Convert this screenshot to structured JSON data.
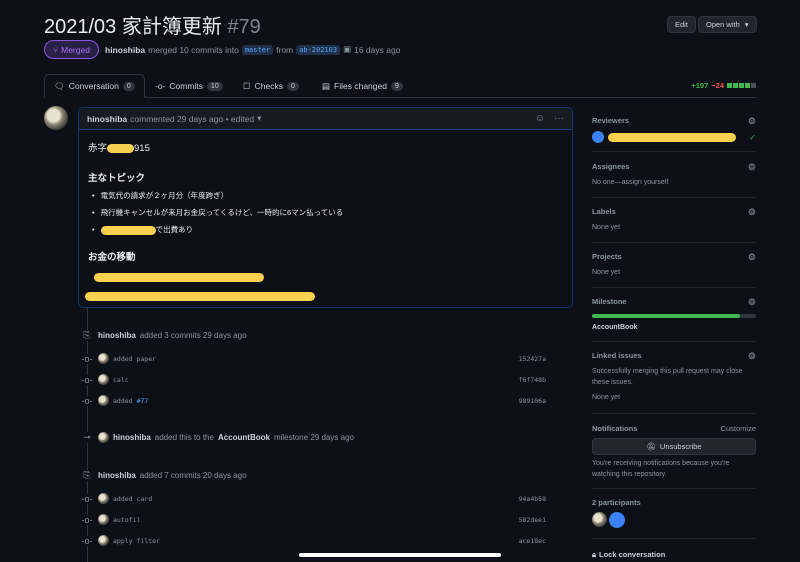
{
  "header": {
    "title": "2021/03 家計簿更新",
    "number": "#79",
    "edit": "Edit",
    "open_with": "Open with"
  },
  "status": {
    "badge": "Merged",
    "author": "hinoshiba",
    "merged_text": "merged 10 commits into",
    "base": "master",
    "from": "from",
    "head": "ab-202103",
    "time": "16 days ago"
  },
  "tabs": [
    {
      "label": "Conversation",
      "count": "0"
    },
    {
      "label": "Commits",
      "count": "10"
    },
    {
      "label": "Checks",
      "count": "0"
    },
    {
      "label": "Files changed",
      "count": "9"
    }
  ],
  "diffstat": {
    "add": "+197",
    "del": "−24"
  },
  "comment": {
    "author": "hinoshiba",
    "meta": "commented 29 days ago • edited",
    "line1_prefix": "赤字",
    "line1_suffix": "915",
    "h_topics": "主なトピック",
    "topics": [
      "電気代の請求が２ヶ月分（年度跨ぎ）",
      "飛行機キャンセルが来月お金戻ってくるけど、一時的に6マン払っている",
      "で出費あり"
    ],
    "h_money": "お金の移動"
  },
  "timeline": [
    {
      "type": "push",
      "author": "hinoshiba",
      "text": "added 3 commits 29 days ago"
    },
    {
      "type": "commit",
      "msg": "added paper",
      "sha": "152427a"
    },
    {
      "type": "commit",
      "msg": "calc",
      "sha": "f6f748b"
    },
    {
      "type": "commit",
      "msg": "added",
      "link": "#77",
      "sha": "989106a"
    },
    {
      "type": "milestone",
      "author": "hinoshiba",
      "text1": "added this to the",
      "milestone": "AccountBook",
      "text2": "milestone 29 days ago"
    },
    {
      "type": "push",
      "author": "hinoshiba",
      "text": "added 7 commits 20 days ago"
    },
    {
      "type": "commit",
      "msg": "added card",
      "sha": "94a4b58"
    },
    {
      "type": "commit",
      "msg": "autofil",
      "sha": "582dee1"
    },
    {
      "type": "commit",
      "msg": "apply filter",
      "sha": "ace18ec"
    }
  ],
  "sidebar": {
    "reviewers": "Reviewers",
    "assignees": "Assignees",
    "assignees_val": "No one—assign yourself",
    "labels": "Labels",
    "labels_val": "None yet",
    "projects": "Projects",
    "projects_val": "None yet",
    "milestone": "Milestone",
    "milestone_val": "AccountBook",
    "milestone_progress": 0.9,
    "linked": "Linked issues",
    "linked_desc": "Successfully merging this pull request may close these issues.",
    "linked_val": "None yet",
    "notifications": "Notifications",
    "customize": "Customize",
    "unsubscribe": "Unsubscribe",
    "notif_desc": "You're receiving notifications because you're watching this repository.",
    "participants": "2 participants",
    "lock": "Lock conversation"
  },
  "colors": {
    "merged": "#a371f7",
    "add": "#3fb950",
    "del": "#f85149",
    "accent": "#58a6ff"
  }
}
